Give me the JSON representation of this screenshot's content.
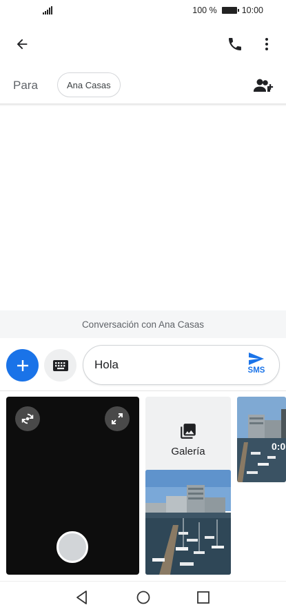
{
  "status_bar": {
    "battery_percent": "100 %",
    "time": "10:00",
    "icons": [
      "signal-icon",
      "battery-icon"
    ]
  },
  "app_bar": {
    "icons": [
      "back-arrow-icon",
      "phone-icon",
      "more-vert-icon"
    ]
  },
  "recipients": {
    "label": "Para",
    "chips": [
      "Ana Casas"
    ],
    "add_icon": "add-person-icon"
  },
  "conversation": {
    "banner": "Conversación con Ana Casas"
  },
  "compose": {
    "message_text": "Hola",
    "send_label": "SMS",
    "accent_color": "#1a73e8",
    "icons": [
      "plus-icon",
      "keyboard-icon",
      "send-icon"
    ]
  },
  "media": {
    "gallery_label": "Galería",
    "video_duration": "0:0",
    "icons": [
      "camera-switch-icon",
      "expand-icon",
      "gallery-icon"
    ]
  },
  "nav_bar": {
    "icons": [
      "nav-back-icon",
      "nav-home-icon",
      "nav-recents-icon"
    ]
  }
}
